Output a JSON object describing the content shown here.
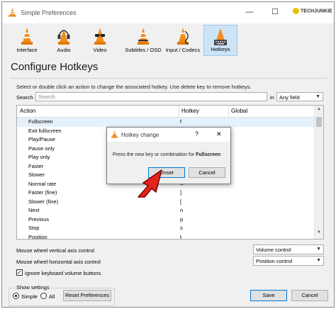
{
  "window": {
    "title": "Simple Preferences",
    "controls": {
      "minimize": "—",
      "maximize": "☐",
      "close": "✕"
    },
    "watermark": "TECHJUNKIE"
  },
  "toolbar": {
    "items": [
      {
        "label": "Interface",
        "icon": "vlc-cone-interface-icon"
      },
      {
        "label": "Audio",
        "icon": "vlc-cone-headphones-icon"
      },
      {
        "label": "Video",
        "icon": "vlc-cone-glasses-icon"
      },
      {
        "label": "Subtitles / OSD",
        "icon": "vlc-cone-subtitles-icon"
      },
      {
        "label": "Input / Codecs",
        "icon": "vlc-cone-cable-icon"
      },
      {
        "label": "Hotkeys",
        "icon": "vlc-cone-keyboard-icon",
        "active": true
      }
    ]
  },
  "page": {
    "heading": "Configure Hotkeys",
    "instructions": "Select or double click an action to change the associated hotkey. Use delete key to remove hotkeys.",
    "search_label": "Search",
    "search_placeholder": "Search",
    "in_label": "in",
    "search_scope": "Any field"
  },
  "table": {
    "headers": {
      "action": "Action",
      "hotkey": "Hotkey",
      "global": "Global"
    },
    "rows": [
      {
        "action": "Fullscreen",
        "hotkey": "f"
      },
      {
        "action": "Exit fullscreen",
        "hotkey": ""
      },
      {
        "action": "Play/Pause",
        "hotkey": ""
      },
      {
        "action": "Pause only",
        "hotkey": ""
      },
      {
        "action": "Play only",
        "hotkey": ""
      },
      {
        "action": "Faster",
        "hotkey": ""
      },
      {
        "action": "Slower",
        "hotkey": ""
      },
      {
        "action": "Normal rate",
        "hotkey": "="
      },
      {
        "action": "Faster (fine)",
        "hotkey": "]"
      },
      {
        "action": "Slower (fine)",
        "hotkey": "["
      },
      {
        "action": "Next",
        "hotkey": "n"
      },
      {
        "action": "Previous",
        "hotkey": "p"
      },
      {
        "action": "Stop",
        "hotkey": "s"
      },
      {
        "action": "Position",
        "hotkey": "t"
      }
    ]
  },
  "mouse": {
    "vertical_label": "Mouse wheel vertical axis control",
    "vertical_value": "Volume control",
    "horizontal_label": "Mouse wheel horizontal axis control",
    "horizontal_value": "Position control",
    "ignore_volume_label": "Ignore keyboard volume buttons."
  },
  "show_settings": {
    "title": "Show settings",
    "simple_label": "Simple",
    "all_label": "All",
    "selected": "Simple"
  },
  "buttons": {
    "reset": "Reset Preferences",
    "save": "Save",
    "cancel": "Cancel"
  },
  "dialog": {
    "title": "Hotkey change",
    "help": "?",
    "close": "✕",
    "message_prefix": "Press the new key or combination for",
    "message_target": "Fullscreen",
    "unset": "Unset",
    "cancel": "Cancel"
  },
  "colors": {
    "accent": "#0078d7",
    "selected_tab": "#cde4f7",
    "arrow": "#e3241b",
    "vlc_orange": "#f28c1a"
  }
}
